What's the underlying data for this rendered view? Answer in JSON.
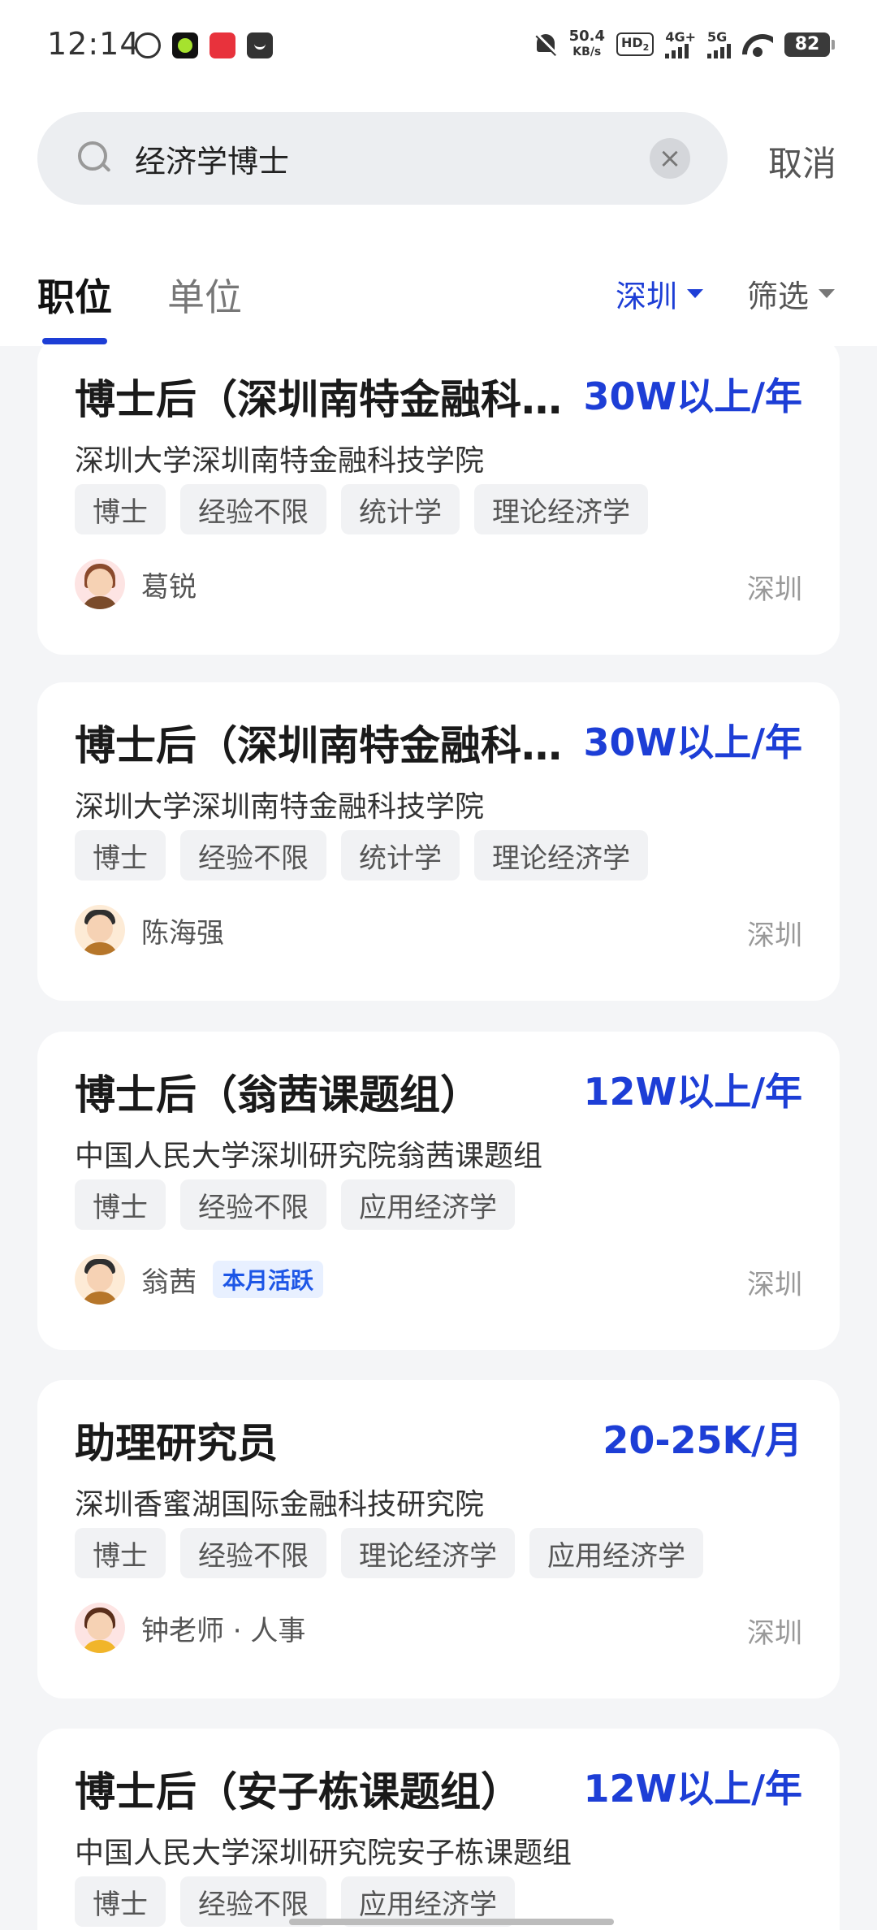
{
  "status_bar": {
    "time": "12:14",
    "app_icons": [
      "emoji-app-icon",
      "green-circle-app-icon",
      "red-app-icon",
      "gray-app-icon"
    ],
    "net_speed_value": "50.4",
    "net_speed_unit": "KB/s",
    "hd_label": "HD",
    "hd_sub": "2",
    "signal_1": "4G+",
    "signal_2": "5G",
    "battery": "82"
  },
  "search": {
    "query": "经济学博士",
    "cancel_label": "取消"
  },
  "tabs": [
    {
      "label": "职位",
      "active": true
    },
    {
      "label": "单位",
      "active": false
    }
  ],
  "filters": {
    "city": "深圳",
    "more": "筛选"
  },
  "colors": {
    "accent": "#1d3ed6",
    "salary": "#1d3ed6",
    "background": "#f4f5f7",
    "card": "#ffffff",
    "tag_bg": "#f1f2f4"
  },
  "jobs": [
    {
      "title": "博士后（深圳南特金融科技学院）",
      "salary": "30W以上/年",
      "org": "深圳大学深圳南特金融科技学院",
      "tags": [
        "博士",
        "经验不限",
        "统计学",
        "理论经济学"
      ],
      "recruiter": "葛锐",
      "badge": "",
      "location": "深圳"
    },
    {
      "title": "博士后（深圳南特金融科技学院）",
      "salary": "30W以上/年",
      "org": "深圳大学深圳南特金融科技学院",
      "tags": [
        "博士",
        "经验不限",
        "统计学",
        "理论经济学"
      ],
      "recruiter": "陈海强",
      "badge": "",
      "location": "深圳"
    },
    {
      "title": "博士后（翁茜课题组）",
      "salary": "12W以上/年",
      "org": "中国人民大学深圳研究院翁茜课题组",
      "tags": [
        "博士",
        "经验不限",
        "应用经济学"
      ],
      "recruiter": "翁茜",
      "badge": "本月活跃",
      "location": "深圳"
    },
    {
      "title": "助理研究员",
      "salary": "20-25K/月",
      "org": "深圳香蜜湖国际金融科技研究院",
      "tags": [
        "博士",
        "经验不限",
        "理论经济学",
        "应用经济学"
      ],
      "recruiter": "钟老师 · 人事",
      "badge": "",
      "location": "深圳"
    },
    {
      "title": "博士后（安子栋课题组）",
      "salary": "12W以上/年",
      "org": "中国人民大学深圳研究院安子栋课题组",
      "tags": [
        "博士",
        "经验不限",
        "应用经济学"
      ],
      "recruiter": "",
      "badge": "",
      "location": ""
    }
  ]
}
